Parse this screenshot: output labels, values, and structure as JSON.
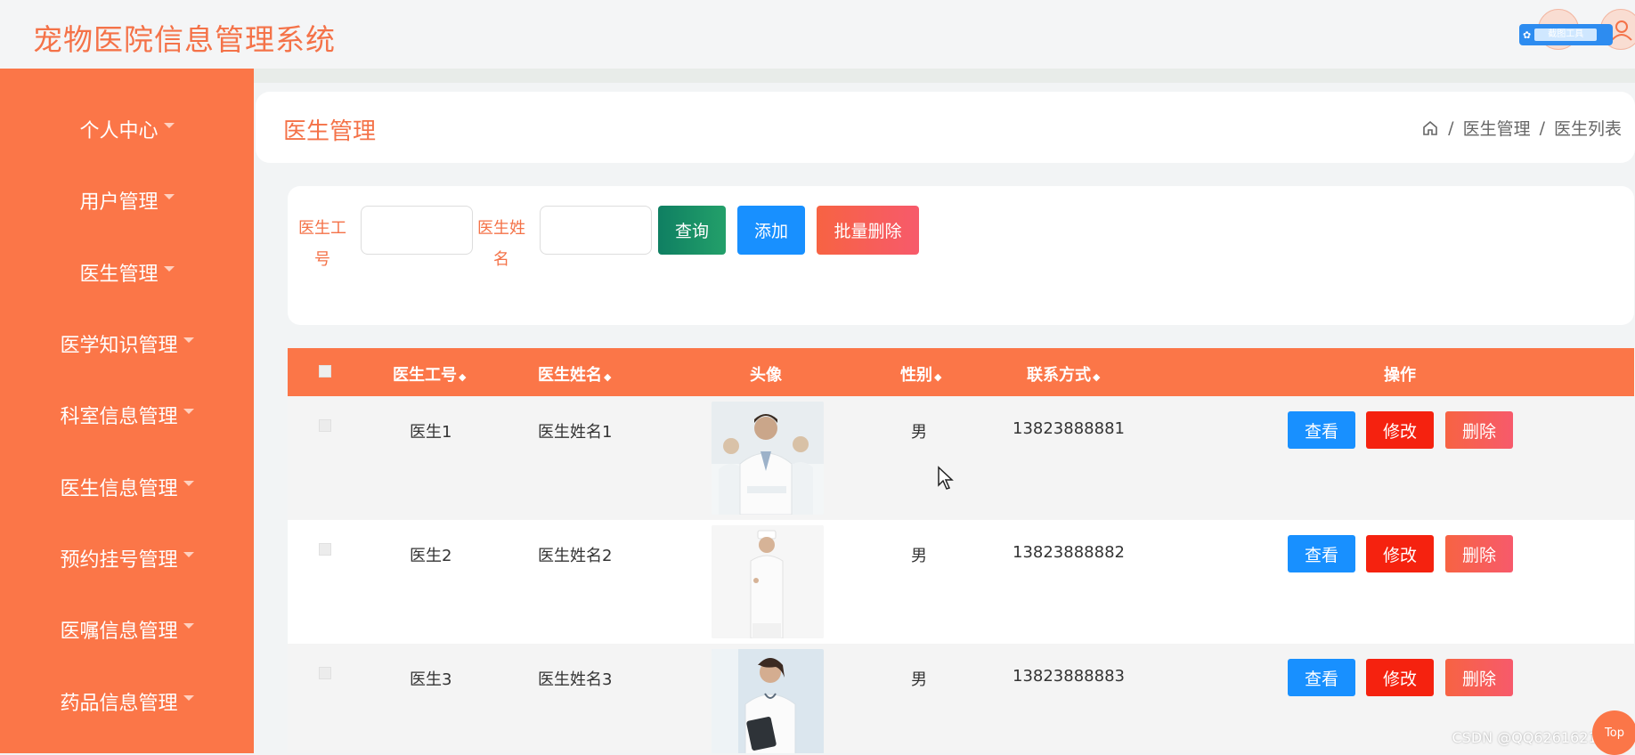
{
  "app": {
    "title": "宠物医院信息管理系统",
    "badge_text": "截图工具"
  },
  "sidebar": {
    "items": [
      {
        "label": "个人中心"
      },
      {
        "label": "用户管理"
      },
      {
        "label": "医生管理"
      },
      {
        "label": "医学知识管理"
      },
      {
        "label": "科室信息管理"
      },
      {
        "label": "医生信息管理"
      },
      {
        "label": "预约挂号管理"
      },
      {
        "label": "医嘱信息管理"
      },
      {
        "label": "药品信息管理"
      }
    ]
  },
  "header": {
    "title": "医生管理",
    "breadcrumb": [
      "医生管理",
      "医生列表"
    ]
  },
  "search": {
    "field1_label_line1": "医生工",
    "field1_label_line2": "号",
    "field1_value": "",
    "field2_label_line1": "医生姓",
    "field2_label_line2": "名",
    "field2_value": "",
    "search_button": "查询",
    "add_button": "添加",
    "batch_delete_button": "批量删除"
  },
  "table": {
    "columns": [
      "医生工号",
      "医生姓名",
      "头像",
      "性别",
      "联系方式",
      "操作"
    ],
    "rows": [
      {
        "id": "医生1",
        "name": "医生姓名1",
        "gender": "男",
        "phone": "13823888881"
      },
      {
        "id": "医生2",
        "name": "医生姓名2",
        "gender": "男",
        "phone": "13823888882"
      },
      {
        "id": "医生3",
        "name": "医生姓名3",
        "gender": "男",
        "phone": "13823888883"
      }
    ],
    "actions": {
      "view": "查看",
      "edit": "修改",
      "delete": "删除"
    }
  },
  "footer": {
    "watermark": "CSDN @QQ626162193",
    "top_button": "Top"
  },
  "colors": {
    "accent": "#fb7648",
    "title": "#f47248",
    "primary_blue": "#1890ff",
    "edit_red": "#f5220f"
  }
}
